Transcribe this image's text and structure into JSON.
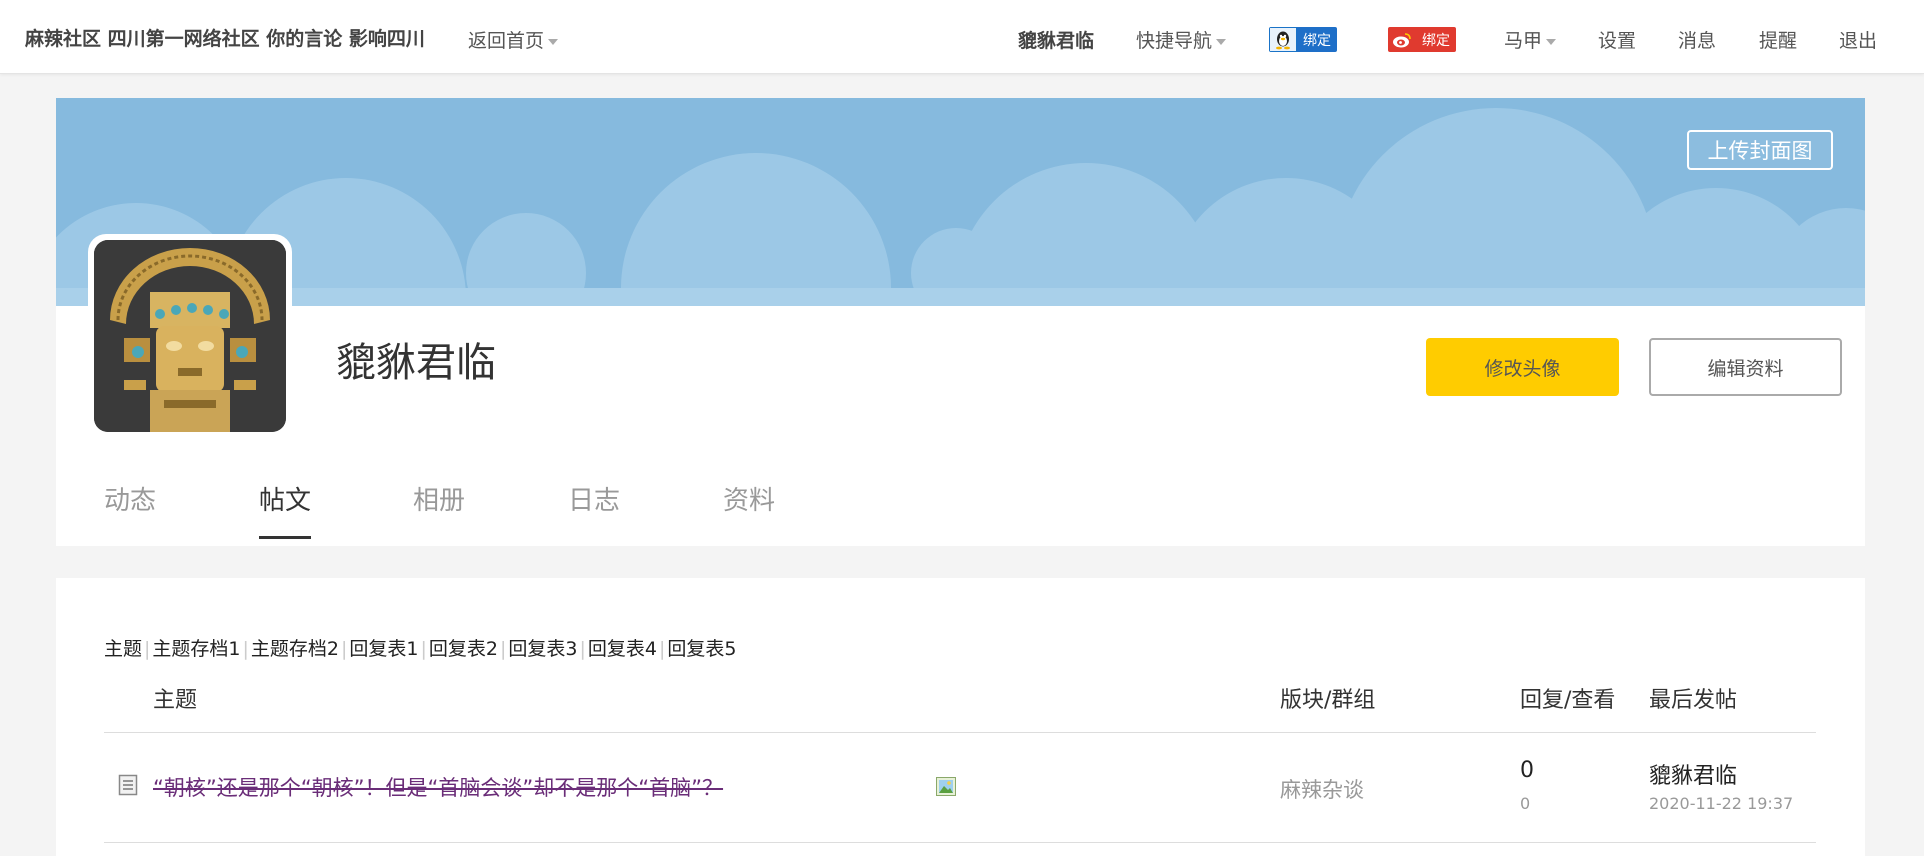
{
  "topbar": {
    "site_title": "麻辣社区 四川第一网络社区 你的言论 影响四川",
    "back_home": "返回首页",
    "username": "貔貅君临",
    "quick_nav": "快捷导航",
    "qq_bind": "绑定",
    "weibo_bind": "绑定",
    "majia": "马甲",
    "settings": "设置",
    "messages": "消息",
    "reminders": "提醒",
    "logout": "退出"
  },
  "profile": {
    "upload_cover": "上传封面图",
    "name": "貔貅君临",
    "change_avatar": "修改头像",
    "edit_profile": "编辑资料",
    "tabs": [
      "动态",
      "帖文",
      "相册",
      "日志",
      "资料"
    ],
    "active_tab": "帖文"
  },
  "posts": {
    "subtabs": [
      "主题",
      "主题存档1",
      "主题存档2",
      "回复表1",
      "回复表2",
      "回复表3",
      "回复表4",
      "回复表5"
    ],
    "headers": {
      "topic": "主题",
      "forum": "版块/群组",
      "reply_view": "回复/查看",
      "last_post": "最后发帖"
    },
    "rows": [
      {
        "title": "“朝核”还是那个“朝核”！但是“首脑会谈”却不是那个“首脑”？",
        "forum": "麻辣杂谈",
        "replies": "0",
        "views": "0",
        "last_user": "貔貅君临",
        "last_time": "2020-11-22 19:37"
      }
    ]
  },
  "colors": {
    "cover_blue": "#8bbfe0",
    "primary_button": "#ffcc00",
    "deleted_title": "#6a2d78"
  }
}
